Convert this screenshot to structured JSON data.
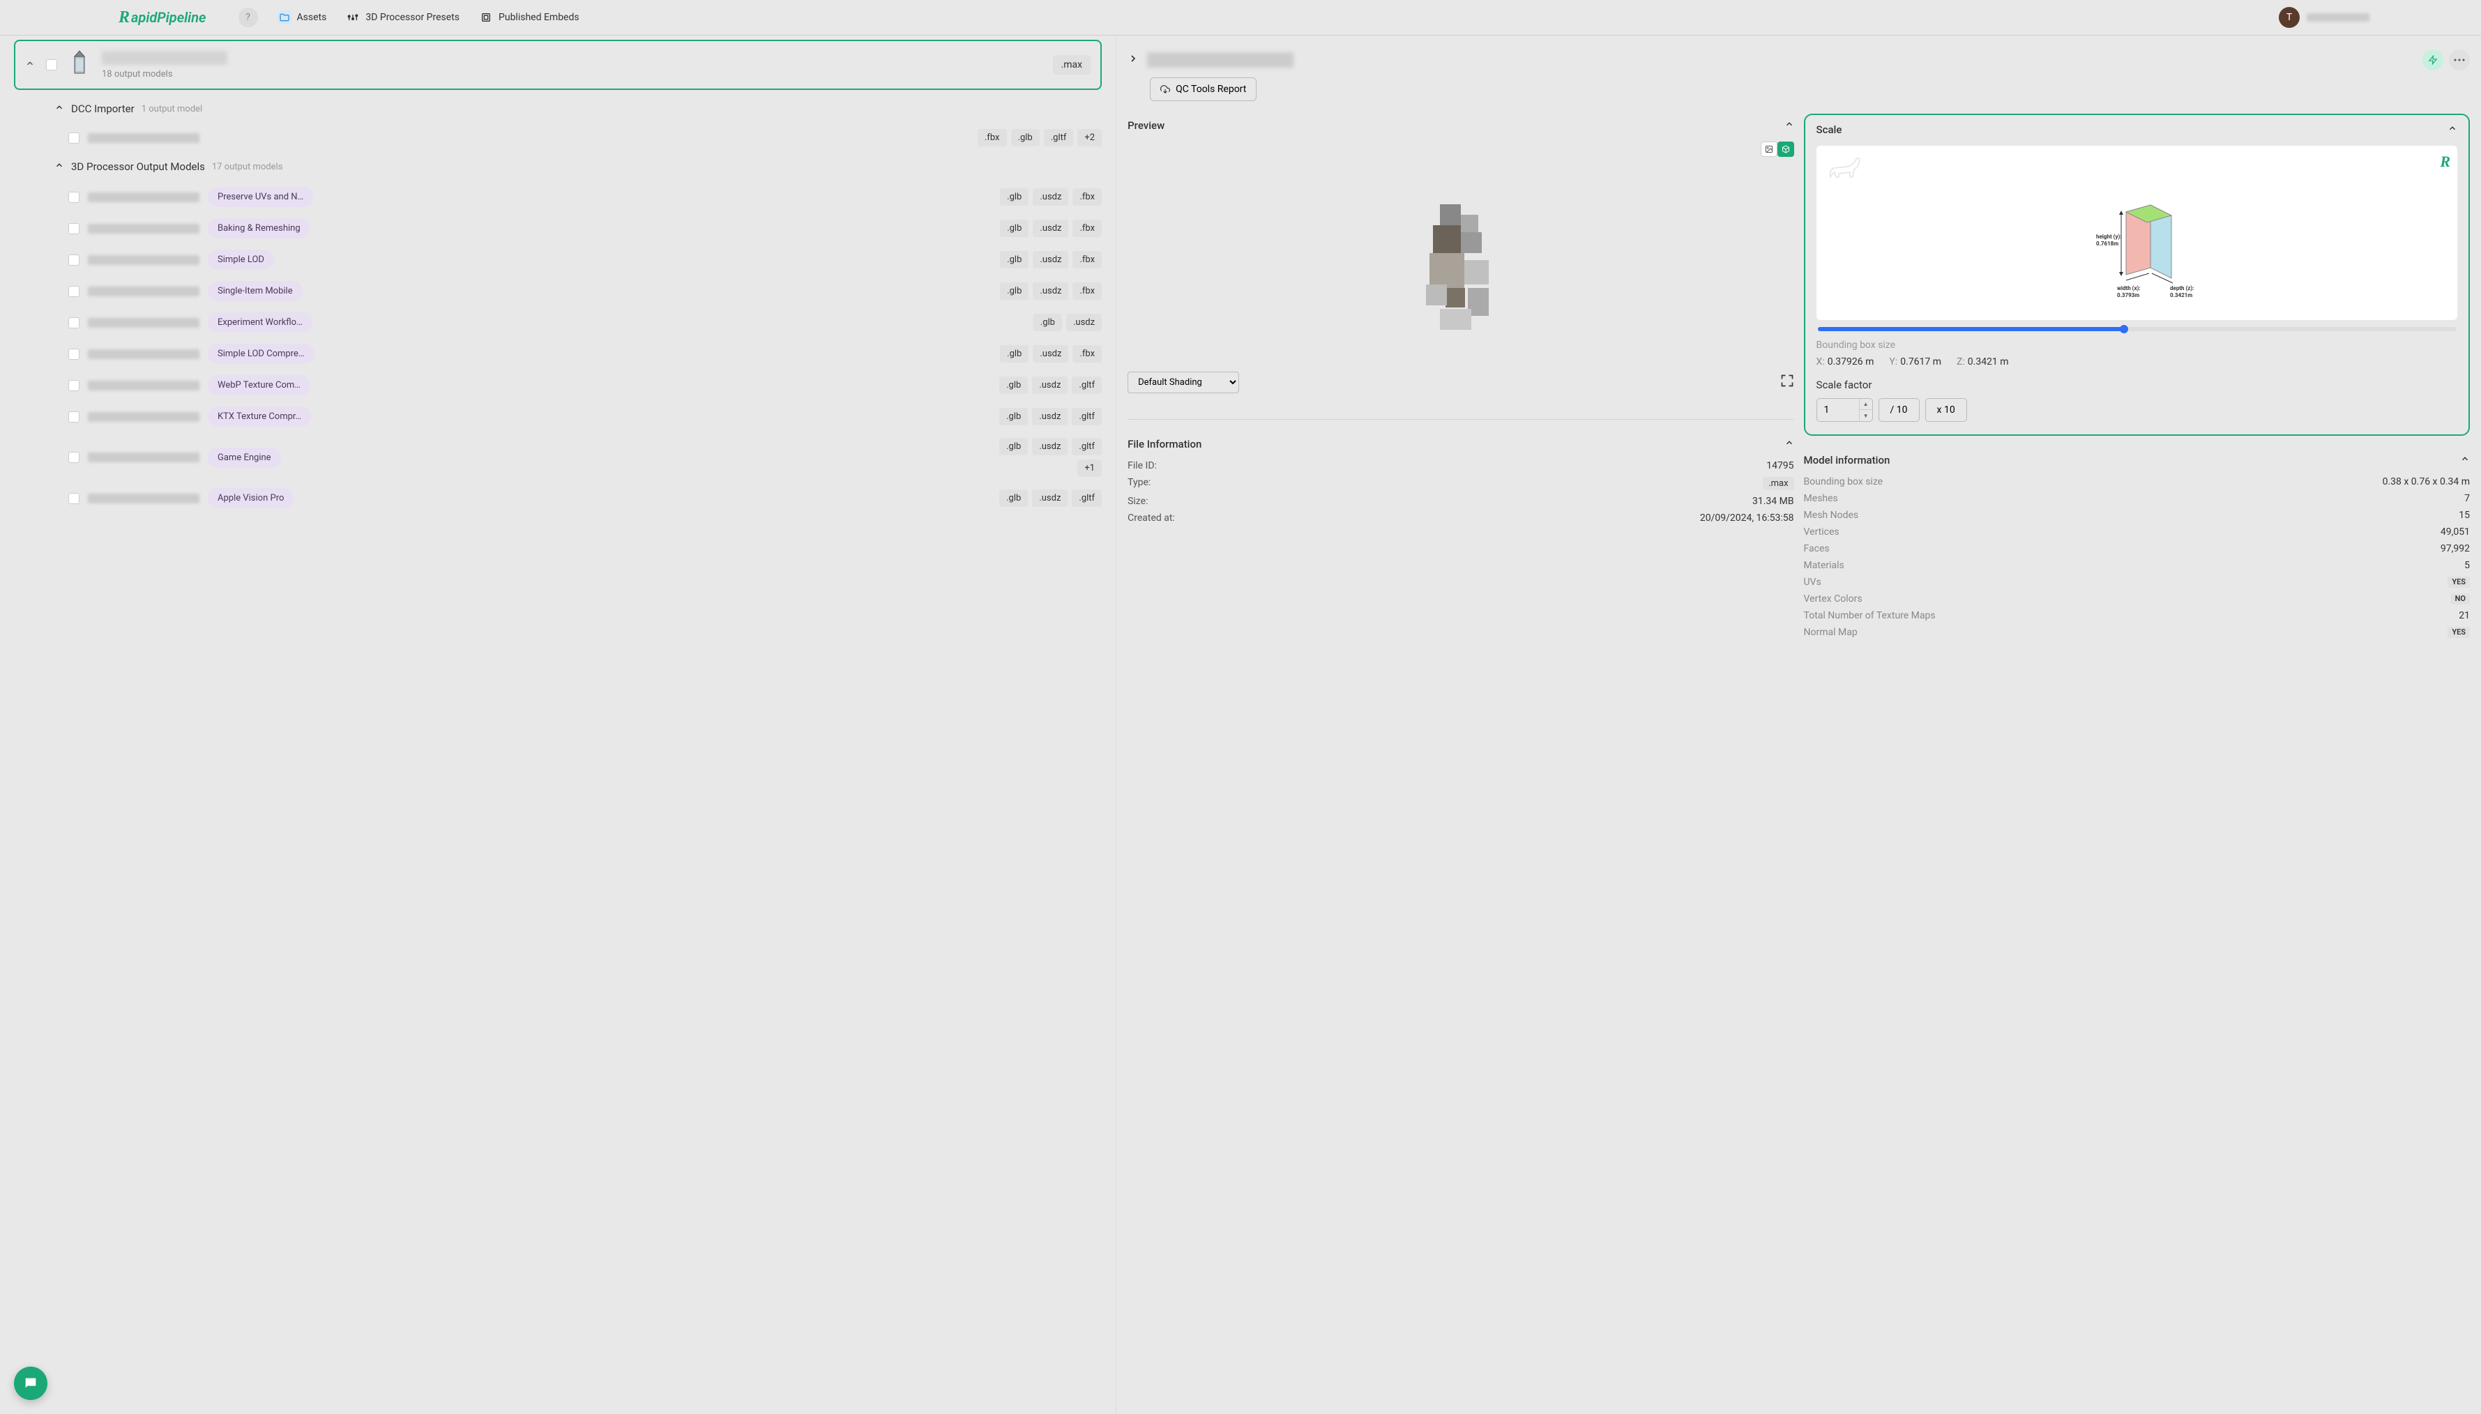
{
  "header": {
    "logo_text": "apidPipeline",
    "help": "?",
    "nav": {
      "assets": "Assets",
      "presets": "3D Processor Presets",
      "embeds": "Published Embeds"
    },
    "avatar_initial": "T"
  },
  "asset": {
    "output_count": "18 output models",
    "format": ".max"
  },
  "sections": {
    "dcc": {
      "title": "DCC Importer",
      "count": "1 output model"
    },
    "processor": {
      "title": "3D Processor Output Models",
      "count": "17 output models"
    }
  },
  "dcc_row_formats": [
    ".fbx",
    ".glb",
    ".gltf",
    "+2"
  ],
  "processor_rows": [
    {
      "preset": "Preserve UVs and N…",
      "formats": [
        ".glb",
        ".usdz",
        ".fbx"
      ]
    },
    {
      "preset": "Baking & Remeshing",
      "formats": [
        ".glb",
        ".usdz",
        ".fbx"
      ]
    },
    {
      "preset": "Simple LOD",
      "formats": [
        ".glb",
        ".usdz",
        ".fbx"
      ]
    },
    {
      "preset": "Single-Item Mobile",
      "formats": [
        ".glb",
        ".usdz",
        ".fbx"
      ]
    },
    {
      "preset": "Experiment Workflo…",
      "formats": [
        ".glb",
        ".usdz"
      ]
    },
    {
      "preset": "Simple LOD Compre…",
      "formats": [
        ".glb",
        ".usdz",
        ".fbx"
      ]
    },
    {
      "preset": "WebP Texture Com…",
      "formats": [
        ".glb",
        ".usdz",
        ".gltf"
      ]
    },
    {
      "preset": "KTX Texture Compr…",
      "formats": [
        ".glb",
        ".usdz",
        ".gltf"
      ]
    },
    {
      "preset": "Game Engine",
      "formats": [
        ".glb",
        ".usdz",
        ".gltf",
        "+1"
      ]
    },
    {
      "preset": "Apple Vision Pro",
      "formats": [
        ".glb",
        ".usdz",
        ".gltf"
      ]
    }
  ],
  "right": {
    "qc_report": "QC Tools Report",
    "preview_title": "Preview",
    "shading_default": "Default Shading",
    "file_info_title": "File Information",
    "file_info": {
      "file_id_label": "File ID:",
      "file_id": "14795",
      "type_label": "Type:",
      "type": ".max",
      "size_label": "Size:",
      "size": "31.34 MB",
      "created_label": "Created at:",
      "created": "20/09/2024, 16:53:58"
    },
    "scale": {
      "title": "Scale",
      "height_label": "height (y):",
      "height_val": "0.7618m",
      "width_label": "width (x):",
      "width_val": "0.3793m",
      "depth_label": "depth (z):",
      "depth_val": "0.3421m",
      "bbs_label": "Bounding box size",
      "x_label": "X:",
      "x_val": "0.37926 m",
      "y_label": "Y:",
      "y_val": "0.7617 m",
      "z_label": "Z:",
      "z_val": "0.3421 m",
      "sf_label": "Scale factor",
      "sf_value": "1",
      "div10": "/ 10",
      "mul10": "x 10"
    },
    "model_info_title": "Model information",
    "model_info": [
      {
        "label": "Bounding box size",
        "value": "0.38 x 0.76 x 0.34 m",
        "cls": ""
      },
      {
        "label": "Meshes",
        "value": "7",
        "cls": ""
      },
      {
        "label": "Mesh Nodes",
        "value": "15",
        "cls": ""
      },
      {
        "label": "Vertices",
        "value": "49,051",
        "cls": ""
      },
      {
        "label": "Faces",
        "value": "97,992",
        "cls": ""
      },
      {
        "label": "Materials",
        "value": "5",
        "cls": ""
      },
      {
        "label": "UVs",
        "value": "YES",
        "cls": "yes"
      },
      {
        "label": "Vertex Colors",
        "value": "NO",
        "cls": "no"
      },
      {
        "label": "Total Number of Texture Maps",
        "value": "21",
        "cls": ""
      },
      {
        "label": "Normal Map",
        "value": "YES",
        "cls": "yes"
      }
    ]
  }
}
